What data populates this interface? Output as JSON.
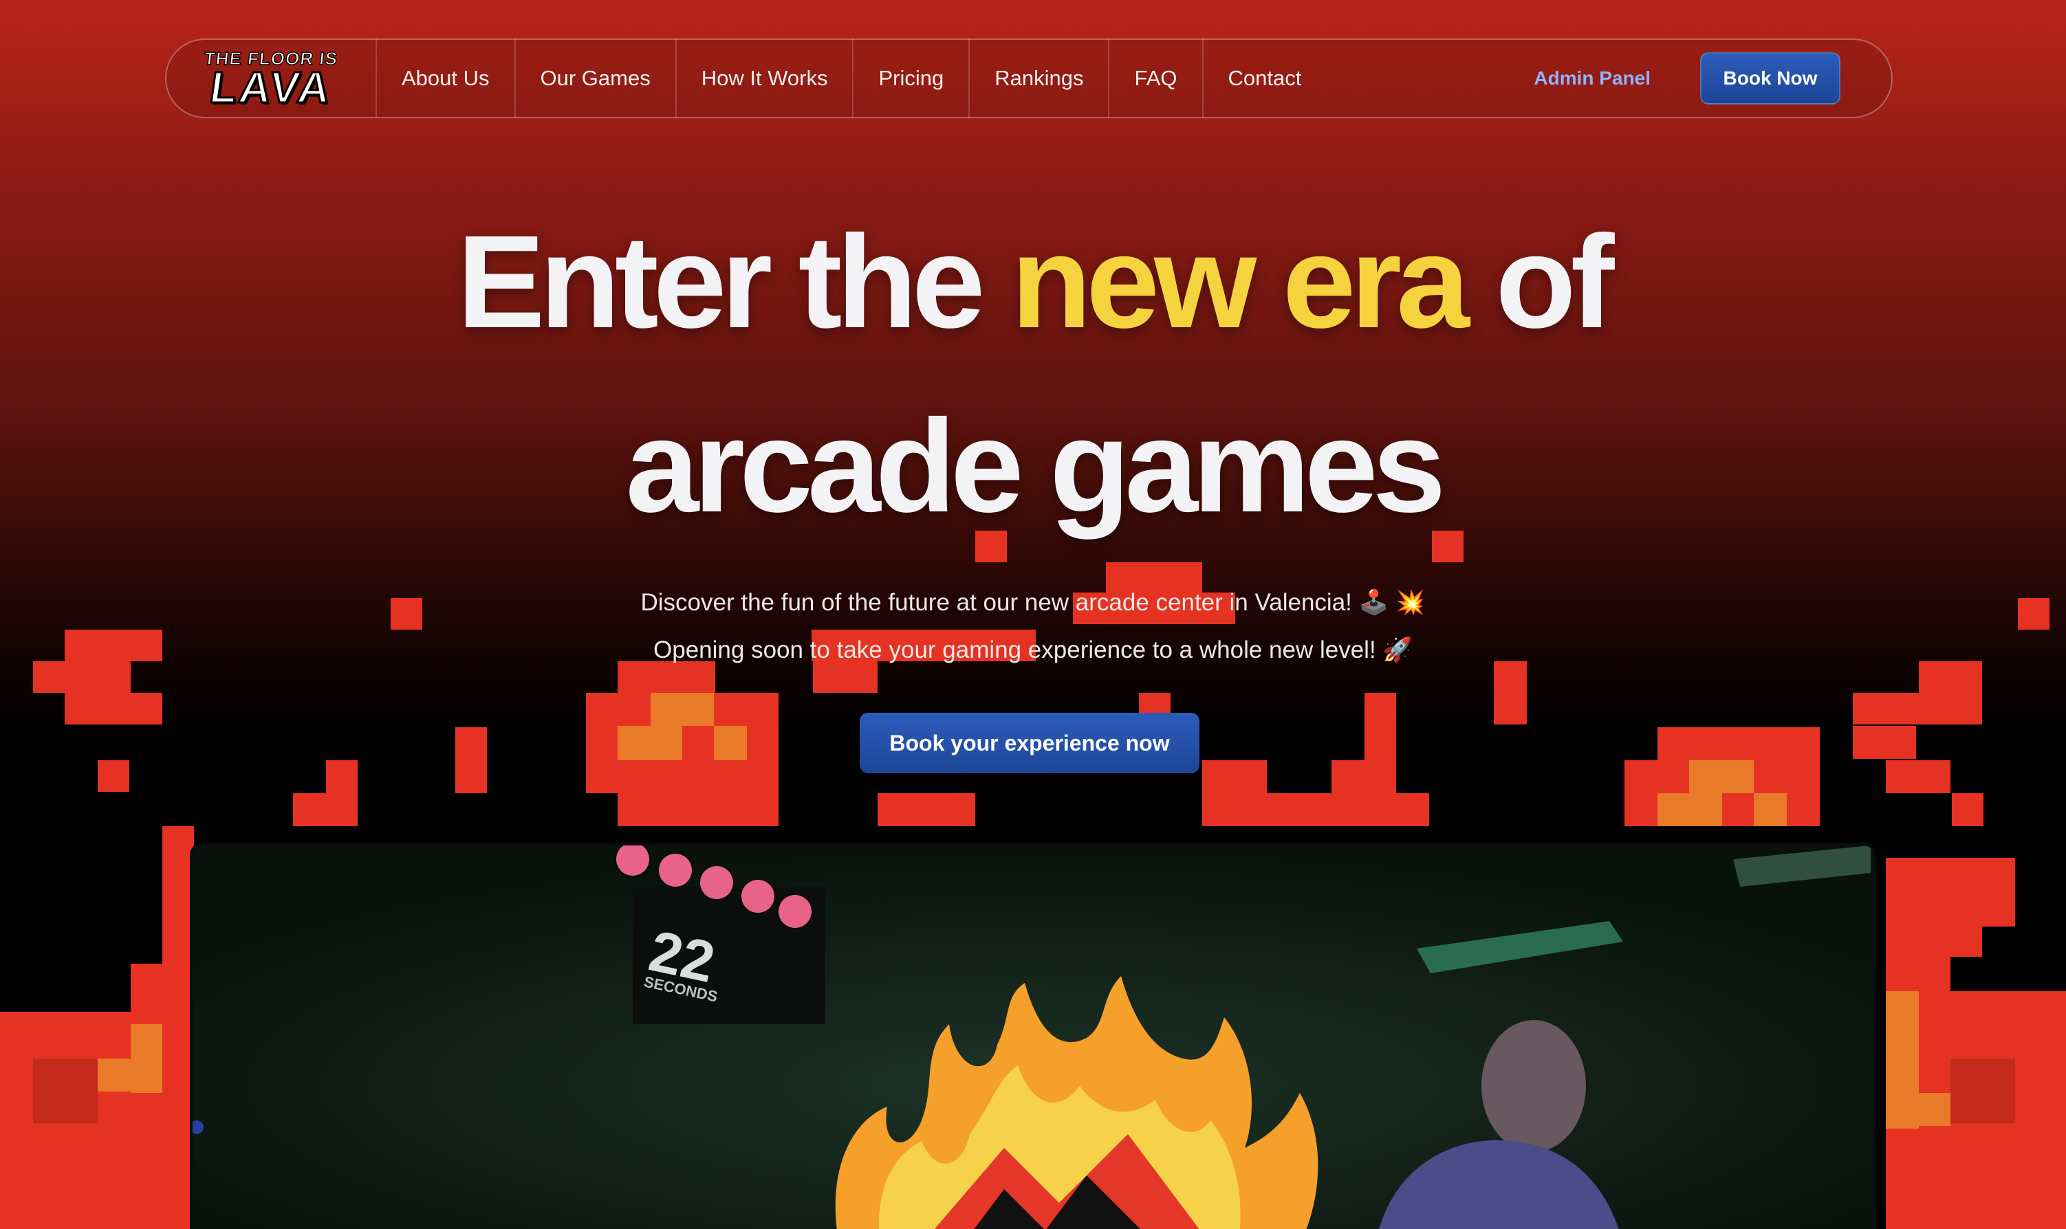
{
  "nav": {
    "logo_top": "THE FLOOR IS",
    "logo_main": "LAVA",
    "links": [
      "About Us",
      "Our Games",
      "How It Works",
      "Pricing",
      "Rankings",
      "FAQ",
      "Contact"
    ],
    "admin_label": "Admin Panel",
    "book_label": "Book Now"
  },
  "hero": {
    "title_part1": "Enter the ",
    "title_accent": "new era",
    "title_part2": " of",
    "title_line2": "arcade games",
    "subtitle_1": "Discover the fun of the future at our new arcade center in Valencia! 🕹️ 💥",
    "subtitle_2": "Opening soon to take your gaming experience to a whole new level! 🚀",
    "cta_label": "Book your experience now"
  },
  "video": {
    "timer_value": "22",
    "timer_unit": "SECONDS",
    "lives": 5
  },
  "colors": {
    "accent_yellow": "#f5d33e",
    "lava_red": "#e53222",
    "lava_orange": "#e87a2a",
    "button_blue": "#2551a8",
    "admin_link": "#8fb3ff"
  }
}
